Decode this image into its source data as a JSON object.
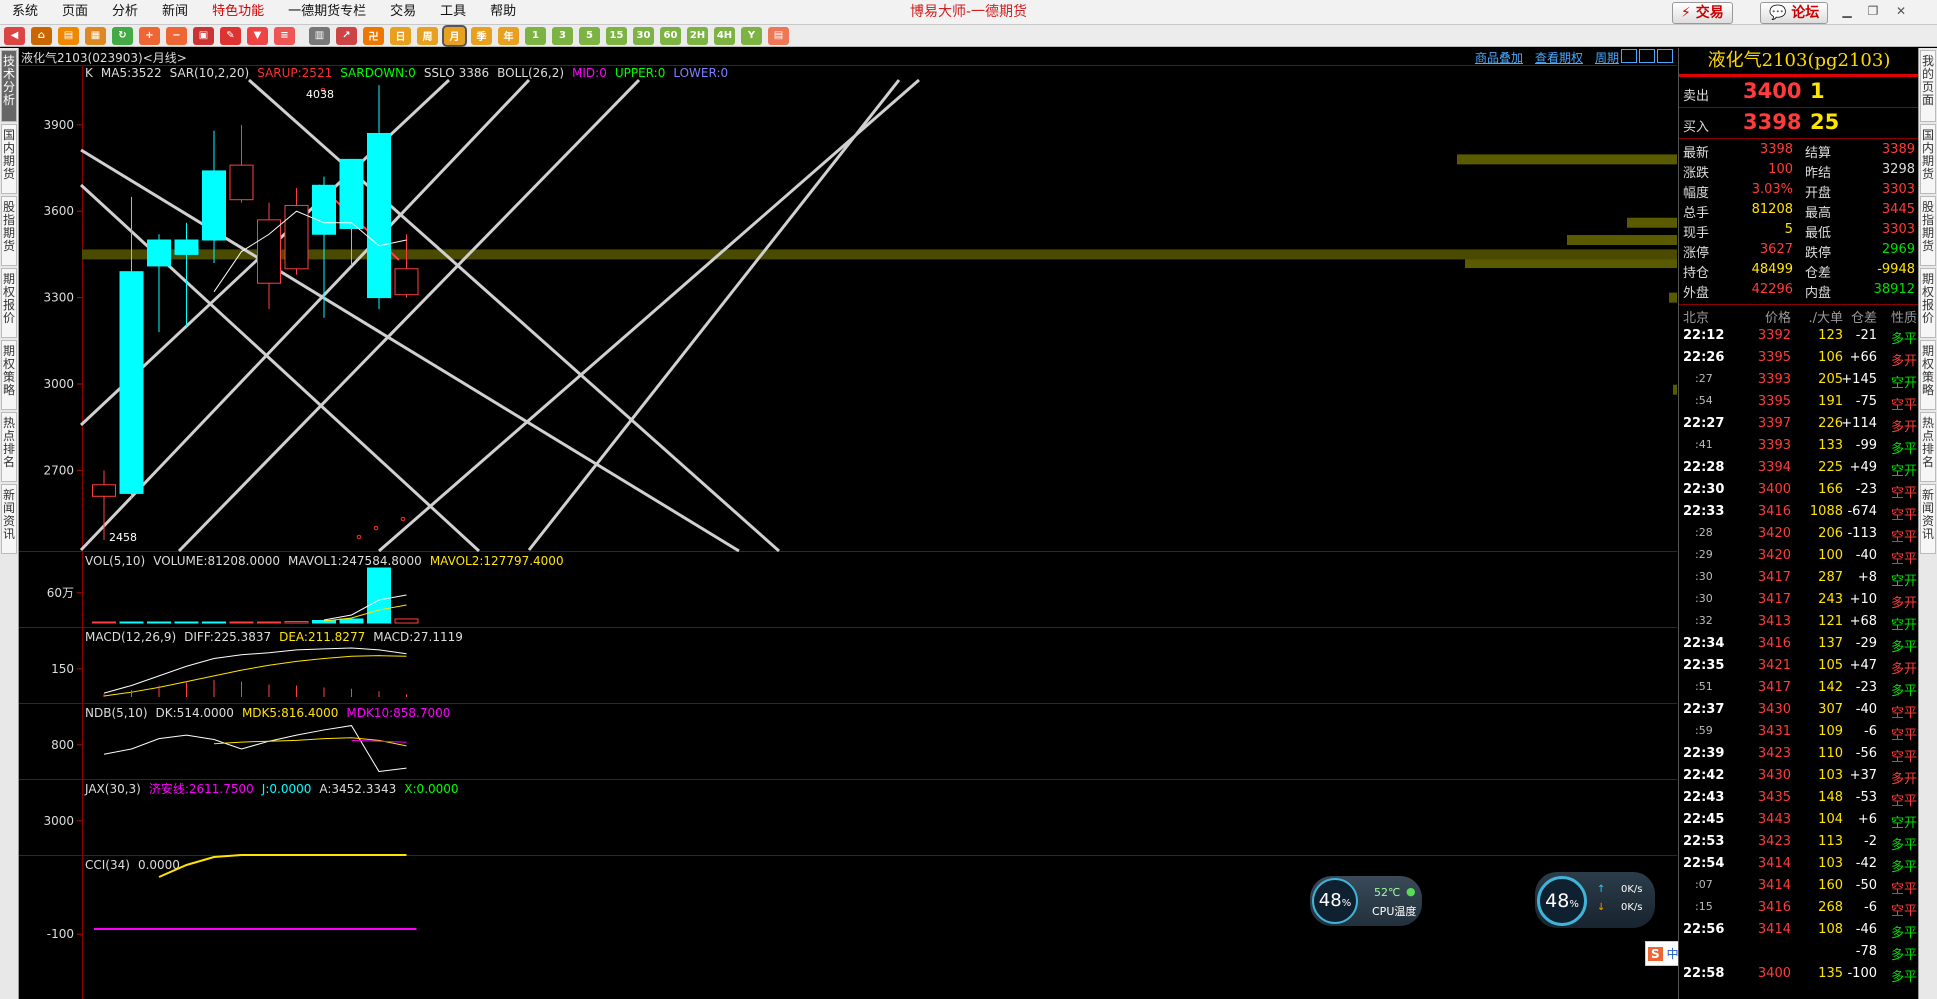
{
  "menu": {
    "items": [
      {
        "label": "系统",
        "hot": false
      },
      {
        "label": "页面",
        "hot": false
      },
      {
        "label": "分析",
        "hot": false
      },
      {
        "label": "新闻",
        "hot": false
      },
      {
        "label": "特色功能",
        "hot": true
      },
      {
        "label": "一德期货专栏",
        "hot": false
      },
      {
        "label": "交易",
        "hot": false
      },
      {
        "label": "工具",
        "hot": false
      },
      {
        "label": "帮助",
        "hot": false
      }
    ]
  },
  "window_title": "博易大师-一德期货",
  "top_buttons": {
    "trade": "交易",
    "forum": "论坛"
  },
  "toolbar": {
    "period_buttons": [
      "日",
      "周",
      "月",
      "季",
      "年",
      "1",
      "3",
      "5",
      "15",
      "30",
      "60",
      "2H",
      "4H",
      "Y"
    ]
  },
  "left_tabs": [
    "技术分析",
    "国内期货",
    "股指期货",
    "期权报价",
    "期权策略",
    "热点排名",
    "新闻资讯"
  ],
  "right_tabs": [
    "我的页面",
    "国内期货",
    "股指期货",
    "期权报价",
    "期权策略",
    "热点排名",
    "新闻资讯"
  ],
  "chart_header": {
    "title": "液化气2103(023903)<月线>",
    "links": [
      "商品叠加",
      "查看期权",
      "周期"
    ]
  },
  "chart_data": {
    "type": "candlestick",
    "main": {
      "indicator_line": [
        {
          "text": "K",
          "color": "#dddddd"
        },
        {
          "text": "MA5:3522",
          "color": "#dddddd"
        },
        {
          "text": "SAR(10,2,20)",
          "color": "#dddddd"
        },
        {
          "text": "SARUP:2521",
          "color": "#ff3030"
        },
        {
          "text": "SARDOWN:0",
          "color": "#00ff00"
        },
        {
          "text": "SSLO 3386",
          "color": "#dddddd"
        },
        {
          "text": "BOLL(26,2)",
          "color": "#dddddd"
        },
        {
          "text": "MID:0",
          "color": "#ff00ff"
        },
        {
          "text": "UPPER:0",
          "color": "#00ff00"
        },
        {
          "text": "LOWER:0",
          "color": "#7f7fff"
        }
      ],
      "y_ticks": [
        3900,
        3600,
        3300,
        3000,
        2700
      ],
      "ylim": [
        2420,
        4080
      ],
      "high_label": "4038",
      "low_label": "2458",
      "candles": [
        {
          "o": 2650,
          "h": 2700,
          "l": 2458,
          "c": 2610
        },
        {
          "o": 2620,
          "h": 3650,
          "l": 2600,
          "c": 3390
        },
        {
          "o": 3410,
          "h": 3520,
          "l": 3180,
          "c": 3500
        },
        {
          "o": 3450,
          "h": 3560,
          "l": 3200,
          "c": 3500
        },
        {
          "o": 3500,
          "h": 3880,
          "l": 3420,
          "c": 3740
        },
        {
          "o": 3760,
          "h": 3900,
          "l": 3630,
          "c": 3640
        },
        {
          "o": 3570,
          "h": 3630,
          "l": 3260,
          "c": 3350
        },
        {
          "o": 3620,
          "h": 3680,
          "l": 3380,
          "c": 3400
        },
        {
          "o": 3520,
          "h": 3720,
          "l": 3230,
          "c": 3690
        },
        {
          "o": 3540,
          "h": 3780,
          "l": 3410,
          "c": 3780
        },
        {
          "o": 3300,
          "h": 4038,
          "l": 3260,
          "c": 3870
        },
        {
          "o": 3400,
          "h": 3520,
          "l": 3300,
          "c": 3310
        }
      ],
      "ma5": [
        null,
        null,
        null,
        null,
        3320,
        3460,
        3520,
        3600,
        3560,
        3560,
        3480,
        3500
      ],
      "volume_profile": [
        {
          "price": 3780,
          "width": 220
        },
        {
          "price": 3560,
          "width": 50
        },
        {
          "price": 3500,
          "width": 110
        },
        {
          "price": 3420,
          "width": 212
        },
        {
          "price": 3300,
          "width": 8
        },
        {
          "price": 2980,
          "width": 4
        }
      ],
      "highlight_price": 3450
    },
    "vol": {
      "label_parts": [
        {
          "text": "VOL(5,10)",
          "color": "#dddddd"
        },
        {
          "text": "VOLUME:81208.0000",
          "color": "#dddddd"
        },
        {
          "text": "MAVOL1:247584.8000",
          "color": "#dddddd"
        },
        {
          "text": "MAVOL2:127797.4000",
          "color": "#ffe400"
        }
      ],
      "y_tick": "60万",
      "values": [
        2000,
        8000,
        10000,
        20000,
        5000,
        15000,
        20000,
        30000,
        50000,
        80000,
        1100000,
        81208
      ]
    },
    "macd": {
      "label_parts": [
        {
          "text": "MACD(12,26,9)",
          "color": "#dddddd"
        },
        {
          "text": "DIFF:225.3837",
          "color": "#dddddd"
        },
        {
          "text": "DEA:211.8277",
          "color": "#ffe400"
        },
        {
          "text": "MACD:27.1119",
          "color": "#dddddd"
        }
      ],
      "y_tick": "150",
      "diff": [
        20,
        60,
        110,
        160,
        200,
        220,
        230,
        245,
        250,
        255,
        245,
        225
      ],
      "dea": [
        5,
        25,
        50,
        80,
        110,
        140,
        165,
        185,
        200,
        212,
        215,
        212
      ],
      "macd": [
        15,
        35,
        60,
        80,
        90,
        80,
        65,
        60,
        50,
        43,
        30,
        13
      ]
    },
    "ndb": {
      "label_parts": [
        {
          "text": "NDB(5,10)",
          "color": "#dddddd"
        },
        {
          "text": "DK:514.0000",
          "color": "#dddddd"
        },
        {
          "text": "MDK5:816.4000",
          "color": "#ffe400"
        },
        {
          "text": "MDK10:858.7000",
          "color": "#ff00ff"
        }
      ],
      "y_tick": "800",
      "dk": [
        720,
        780,
        900,
        940,
        890,
        780,
        870,
        940,
        1000,
        1050,
        520,
        560
      ],
      "mdk5": [
        null,
        null,
        null,
        null,
        840,
        860,
        870,
        880,
        900,
        910,
        880,
        816
      ],
      "mdk10": [
        null,
        null,
        null,
        null,
        null,
        null,
        null,
        null,
        null,
        880,
        870,
        858
      ]
    },
    "jax": {
      "label_parts": [
        {
          "text": "JAX(30,3)",
          "color": "#dddddd"
        },
        {
          "text": "济安线:2611.7500",
          "color": "#ff00ff"
        },
        {
          "text": "J:0.0000",
          "color": "#00ffff"
        },
        {
          "text": "A:3452.3343",
          "color": "#dddddd"
        },
        {
          "text": "X:0.0000",
          "color": "#00ff00"
        }
      ],
      "y_tick": "3000"
    },
    "cci": {
      "label_parts": [
        {
          "text": "CCI(34)",
          "color": "#dddddd"
        },
        {
          "text": "0.0000",
          "color": "#dddddd"
        }
      ],
      "y_tick": "-100"
    }
  },
  "widgets": {
    "cpu_percent": "48",
    "cpu_temp": "52℃",
    "cpu_temp_label": "CPU温度",
    "net_percent": "48",
    "net_up": "0K/s",
    "net_down": "0K/s"
  },
  "ime": {
    "label": "中"
  },
  "quote": {
    "name": "液化气2103(pg2103)",
    "sell": {
      "label": "卖出",
      "price": "3400",
      "vol": "1"
    },
    "buy": {
      "label": "买入",
      "price": "3398",
      "vol": "25"
    },
    "fields": [
      {
        "l1": "最新",
        "v1": "3398",
        "c1": "#ff3b3b",
        "l2": "结算",
        "v2": "3389",
        "c2": "#ff3b3b"
      },
      {
        "l1": "涨跌",
        "v1": "100",
        "c1": "#ff3b3b",
        "l2": "昨结",
        "v2": "3298",
        "c2": "#dddddd"
      },
      {
        "l1": "幅度",
        "v1": "3.03%",
        "c1": "#ff3b3b",
        "l2": "开盘",
        "v2": "3303",
        "c2": "#ff3b3b"
      },
      {
        "l1": "总手",
        "v1": "81208",
        "c1": "#ffe400",
        "l2": "最高",
        "v2": "3445",
        "c2": "#ff3b3b"
      },
      {
        "l1": "现手",
        "v1": "5",
        "c1": "#ffe400",
        "l2": "最低",
        "v2": "3303",
        "c2": "#ff3b3b"
      },
      {
        "l1": "涨停",
        "v1": "3627",
        "c1": "#ff3b3b",
        "l2": "跌停",
        "v2": "2969",
        "c2": "#00e000"
      },
      {
        "l1": "持仓",
        "v1": "48499",
        "c1": "#ffe400",
        "l2": "仓差",
        "v2": "-9948",
        "c2": "#ffe400"
      },
      {
        "l1": "外盘",
        "v1": "42296",
        "c1": "#ff3b3b",
        "l2": "内盘",
        "v2": "38912",
        "c2": "#00e000"
      }
    ],
    "tick_headers": [
      "北京",
      "价格",
      "./大单",
      "仓差",
      "性质"
    ],
    "ticks": [
      {
        "t": "22:12",
        "p": "3392",
        "v": "123",
        "d": "-21",
        "n": "多平",
        "nc": "#00e000"
      },
      {
        "t": "22:26",
        "p": "3395",
        "v": "106",
        "d": "+66",
        "n": "多开",
        "nc": "#ff3b3b"
      },
      {
        "t": ":27",
        "p": "3393",
        "v": "205",
        "d": "+145",
        "n": "空开",
        "nc": "#00e000"
      },
      {
        "t": ":54",
        "p": "3395",
        "v": "191",
        "d": "-75",
        "n": "空平",
        "nc": "#ff3b3b"
      },
      {
        "t": "22:27",
        "p": "3397",
        "v": "226",
        "d": "+114",
        "n": "多开",
        "nc": "#ff3b3b"
      },
      {
        "t": ":41",
        "p": "3393",
        "v": "133",
        "d": "-99",
        "n": "多平",
        "nc": "#00e000"
      },
      {
        "t": "22:28",
        "p": "3394",
        "v": "225",
        "d": "+49",
        "n": "空开",
        "nc": "#00e000"
      },
      {
        "t": "22:30",
        "p": "3400",
        "v": "166",
        "d": "-23",
        "n": "空平",
        "nc": "#ff3b3b"
      },
      {
        "t": "22:33",
        "p": "3416",
        "v": "1088",
        "d": "-674",
        "n": "空平",
        "nc": "#ff3b3b"
      },
      {
        "t": ":28",
        "p": "3420",
        "v": "206",
        "d": "-113",
        "n": "空平",
        "nc": "#ff3b3b"
      },
      {
        "t": ":29",
        "p": "3420",
        "v": "100",
        "d": "-40",
        "n": "空平",
        "nc": "#ff3b3b"
      },
      {
        "t": ":30",
        "p": "3417",
        "v": "287",
        "d": "+8",
        "n": "空开",
        "nc": "#00e000"
      },
      {
        "t": ":30",
        "p": "3417",
        "v": "243",
        "d": "+10",
        "n": "多开",
        "nc": "#ff3b3b"
      },
      {
        "t": ":32",
        "p": "3413",
        "v": "121",
        "d": "+68",
        "n": "空开",
        "nc": "#00e000"
      },
      {
        "t": "22:34",
        "p": "3416",
        "v": "137",
        "d": "-29",
        "n": "多平",
        "nc": "#00e000"
      },
      {
        "t": "22:35",
        "p": "3421",
        "v": "105",
        "d": "+47",
        "n": "多开",
        "nc": "#ff3b3b"
      },
      {
        "t": ":51",
        "p": "3417",
        "v": "142",
        "d": "-23",
        "n": "多平",
        "nc": "#00e000"
      },
      {
        "t": "22:37",
        "p": "3430",
        "v": "307",
        "d": "-40",
        "n": "空平",
        "nc": "#ff3b3b"
      },
      {
        "t": ":59",
        "p": "3431",
        "v": "109",
        "d": "-6",
        "n": "空平",
        "nc": "#ff3b3b"
      },
      {
        "t": "22:39",
        "p": "3423",
        "v": "110",
        "d": "-56",
        "n": "空平",
        "nc": "#ff3b3b"
      },
      {
        "t": "22:42",
        "p": "3430",
        "v": "103",
        "d": "+37",
        "n": "多开",
        "nc": "#ff3b3b"
      },
      {
        "t": "22:43",
        "p": "3435",
        "v": "148",
        "d": "-53",
        "n": "空平",
        "nc": "#ff3b3b"
      },
      {
        "t": "22:45",
        "p": "3443",
        "v": "104",
        "d": "+6",
        "n": "空开",
        "nc": "#00e000"
      },
      {
        "t": "22:53",
        "p": "3423",
        "v": "113",
        "d": "-2",
        "n": "多平",
        "nc": "#00e000"
      },
      {
        "t": "22:54",
        "p": "3414",
        "v": "103",
        "d": "-42",
        "n": "多平",
        "nc": "#00e000"
      },
      {
        "t": ":07",
        "p": "3414",
        "v": "160",
        "d": "-50",
        "n": "空平",
        "nc": "#ff3b3b"
      },
      {
        "t": ":15",
        "p": "3416",
        "v": "268",
        "d": "-6",
        "n": "空平",
        "nc": "#ff3b3b"
      },
      {
        "t": "22:56",
        "p": "3414",
        "v": "108",
        "d": "-46",
        "n": "多平",
        "nc": "#00e000"
      },
      {
        "t": "",
        "p": "",
        "v": "",
        "d": "-78",
        "n": "多平",
        "nc": "#00e000"
      },
      {
        "t": "22:58",
        "p": "3400",
        "v": "135",
        "d": "-100",
        "n": "多平",
        "nc": "#00e000"
      }
    ]
  }
}
